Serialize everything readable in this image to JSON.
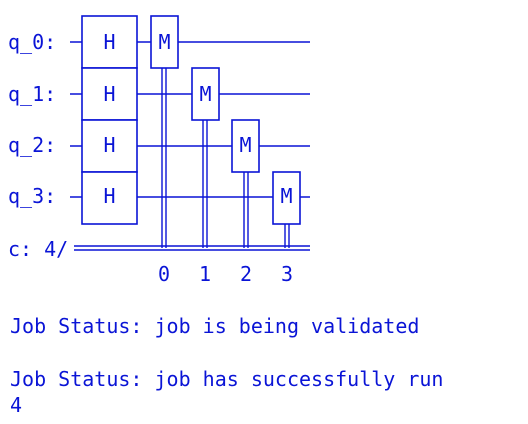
{
  "circuit": {
    "qubit_labels": [
      "q_0:",
      "q_1:",
      "q_2:",
      "q_3:"
    ],
    "classical_label": "c: 4/",
    "h_gate_label": "H",
    "measure_label": "M",
    "bit_indices": [
      "0",
      "1",
      "2",
      "3"
    ]
  },
  "output": {
    "status_validating": "Job Status: job is being validated",
    "status_done": "Job Status: job has successfully run",
    "result": "4"
  },
  "colors": {
    "text": "#0a14d6",
    "background": "#ffffff"
  }
}
